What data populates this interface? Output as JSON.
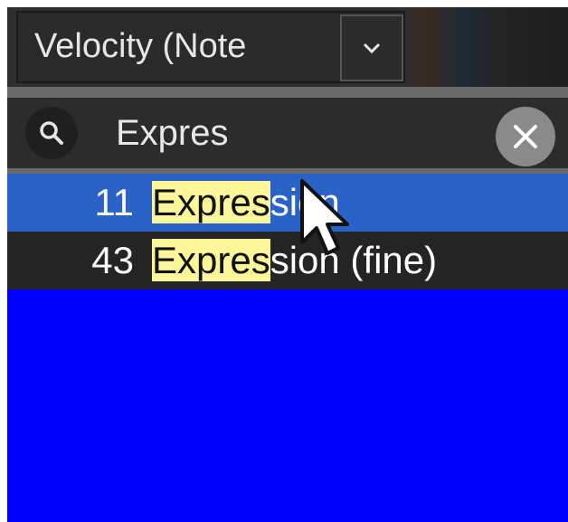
{
  "dropdown": {
    "label": "Velocity (Note",
    "arrow_icon": "chevron-down-icon"
  },
  "search": {
    "value": "Expres",
    "search_icon": "search-icon",
    "clear_icon": "close-icon"
  },
  "results": [
    {
      "number": "11",
      "match": "Expres",
      "rest": "sion",
      "selected": true
    },
    {
      "number": "43",
      "match": "Expres",
      "rest": "sion (fine)",
      "selected": false
    }
  ],
  "colors": {
    "selected_row": "#2a63c8",
    "highlight": "#fbf69a",
    "empty_area": "#0000ff"
  }
}
